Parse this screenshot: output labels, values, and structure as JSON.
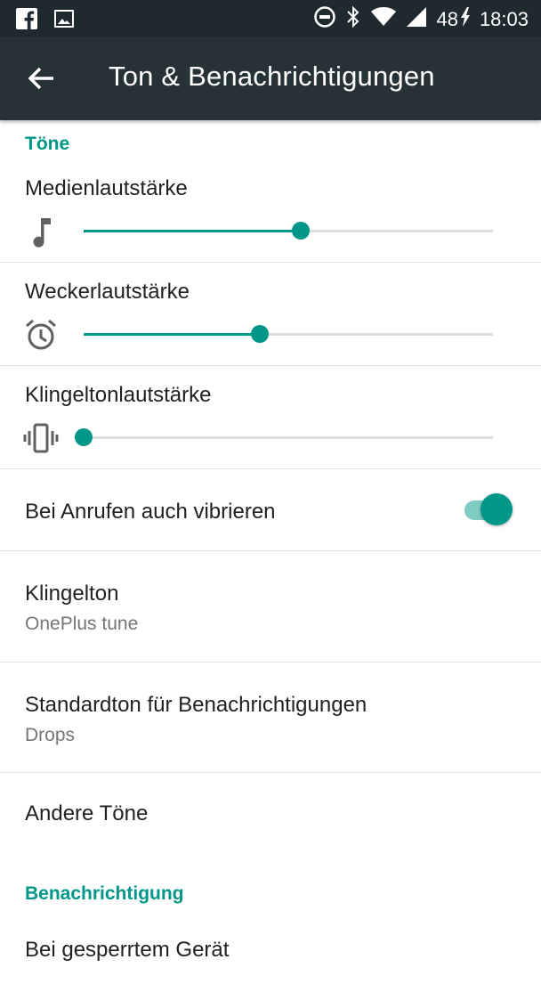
{
  "status_bar": {
    "battery_level": "48",
    "time": "18:03",
    "icons": [
      "facebook-icon",
      "image-icon",
      "do-not-disturb-icon",
      "bluetooth-icon",
      "wifi-icon",
      "cell-signal-icon",
      "battery-charging-icon"
    ]
  },
  "app_bar": {
    "title": "Ton & Benachrichtigungen",
    "back_icon": "arrow-back-icon"
  },
  "sections": {
    "tones": {
      "header": "Töne",
      "media_volume": {
        "label": "Medienlautstärke",
        "icon": "music-note-icon",
        "level_percent": 53
      },
      "alarm_volume": {
        "label": "Weckerlautstärke",
        "icon": "alarm-icon",
        "level_percent": 43
      },
      "ring_volume": {
        "label": "Klingeltonlautstärke",
        "icon": "vibrate-icon",
        "level_percent": 0
      },
      "vibrate_on_call": {
        "label": "Bei Anrufen auch vibrieren",
        "enabled": true
      },
      "ringtone": {
        "label": "Klingelton",
        "value": "OnePlus tune"
      },
      "notification_sound": {
        "label": "Standardton für Benachrichtigungen",
        "value": "Drops"
      },
      "other_sounds": {
        "label": "Andere Töne"
      }
    },
    "notification": {
      "header": "Benachrichtigung",
      "locked_device": {
        "label": "Bei gesperrtem Gerät"
      }
    }
  },
  "colors": {
    "accent": "#009688",
    "accent_light": "#80cbc4",
    "status_bar": "#1e2a30",
    "app_bar": "#263238"
  }
}
